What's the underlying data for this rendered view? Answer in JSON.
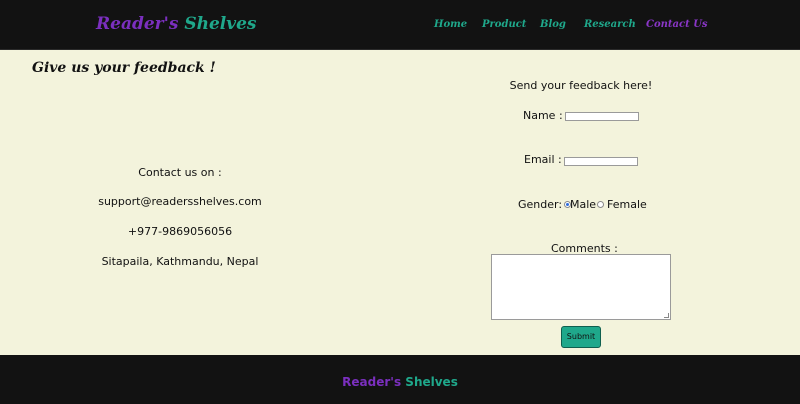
{
  "header": {
    "brand_part1": "Reader's",
    "brand_part2": "Shelves",
    "nav": {
      "home": "Home",
      "product": "Product",
      "blog": "Blog",
      "research": "Research",
      "contact": "Contact Us"
    }
  },
  "left": {
    "feedback_title": "Give us your feedback !",
    "contact_heading": "Contact us on :",
    "email": "support@readersshelves.com",
    "phone": "+977-9869056056",
    "address": "Sitapaila, Kathmandu, Nepal"
  },
  "form": {
    "heading": "Send your feedback here!",
    "name_label": "Name :",
    "name_value": "",
    "email_label": "Email :",
    "email_value": "",
    "gender_label": "Gender:",
    "gender_options": [
      "Male",
      "Female"
    ],
    "gender_selected": "Male",
    "comments_label": "Comments :",
    "comments_value": "",
    "submit_label": "Submit"
  },
  "footer": {
    "brand_part1": "Reader's",
    "brand_part2": "Shelves"
  },
  "colors": {
    "purple": "#7b2fbf",
    "teal": "#1fa88b",
    "page_bg": "#f3f3dc",
    "bar_bg": "#121212"
  }
}
